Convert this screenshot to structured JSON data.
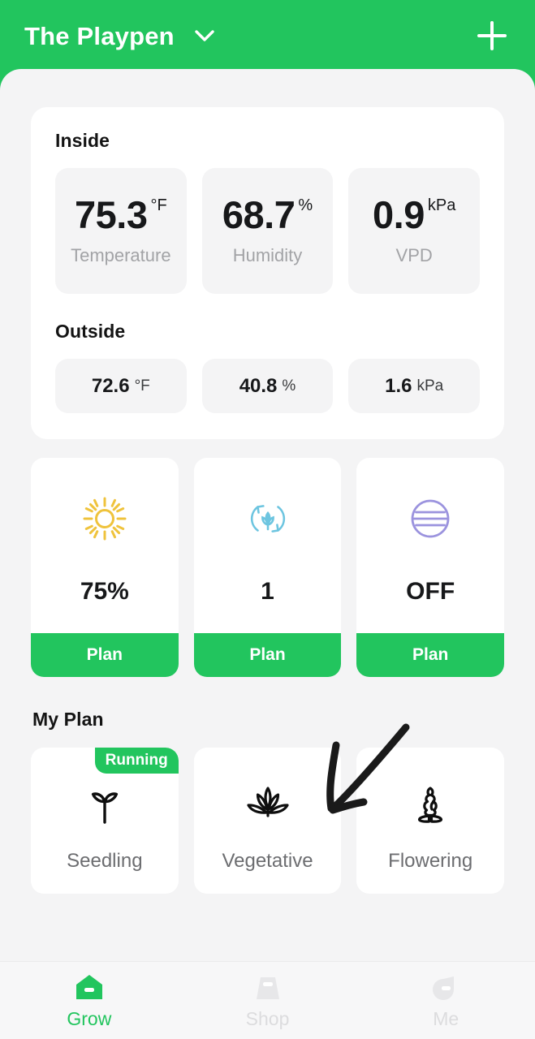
{
  "header": {
    "title": "The Playpen",
    "chevron_icon": "chevron-down-icon",
    "add_icon": "plus-icon",
    "bg_color": "#22C55E"
  },
  "climate": {
    "inside_label": "Inside",
    "outside_label": "Outside",
    "inside": [
      {
        "value": "75.3",
        "unit": "°F",
        "label": "Temperature"
      },
      {
        "value": "68.7",
        "unit": "%",
        "label": "Humidity"
      },
      {
        "value": "0.9",
        "unit": "kPa",
        "label": "VPD"
      }
    ],
    "outside": [
      {
        "value": "72.6",
        "unit": "°F"
      },
      {
        "value": "40.8",
        "unit": "%"
      },
      {
        "value": "1.6",
        "unit": "kPa"
      }
    ]
  },
  "devices": [
    {
      "icon": "sun-icon",
      "icon_color": "#EFC33C",
      "value": "75%",
      "action_label": "Plan"
    },
    {
      "icon": "circulation-leaf-icon",
      "icon_color": "#6DC5E0",
      "value": "1",
      "action_label": "Plan"
    },
    {
      "icon": "striped-circle-icon",
      "icon_color": "#9B93DE",
      "value": "OFF",
      "action_label": "Plan"
    }
  ],
  "my_plan": {
    "title": "My Plan",
    "stages": [
      {
        "name": "Seedling",
        "icon": "sprout-icon",
        "badge": "Running"
      },
      {
        "name": "Vegetative",
        "icon": "cannabis-leaf-icon",
        "badge": ""
      },
      {
        "name": "Flowering",
        "icon": "flower-bud-icon",
        "badge": ""
      }
    ]
  },
  "bottom_nav": {
    "items": [
      {
        "label": "Grow",
        "icon": "grow-tent-icon",
        "active": true
      },
      {
        "label": "Shop",
        "icon": "shopping-bag-icon",
        "active": false
      },
      {
        "label": "Me",
        "icon": "profile-icon",
        "active": false
      }
    ]
  },
  "annotation": {
    "type": "hand-drawn-arrow",
    "color": "#1A1A1A",
    "points_to": "Vegetative"
  }
}
